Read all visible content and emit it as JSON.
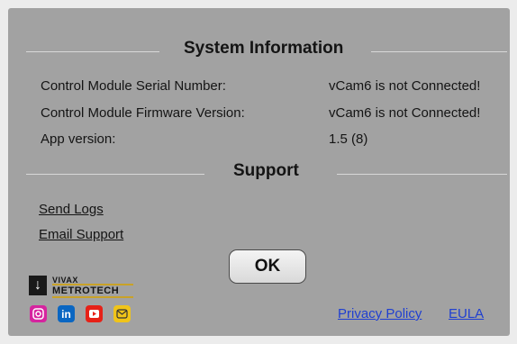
{
  "system_info": {
    "title": "System Information",
    "rows": [
      {
        "label": "Control Module Serial Number:",
        "value": "vCam6 is not Connected!"
      },
      {
        "label": "Control Module Firmware Version:",
        "value": "vCam6 is not Connected!"
      },
      {
        "label": "App version:",
        "value": "1.5 (8)"
      }
    ]
  },
  "support": {
    "title": "Support",
    "send_logs": "Send Logs",
    "email_support": "Email Support"
  },
  "ok_label": "OK",
  "logo": {
    "line1": "VIVAX",
    "line2": "METROTECH"
  },
  "social": [
    {
      "icon": "instagram-icon",
      "color": "#d6249f"
    },
    {
      "icon": "linkedin-icon",
      "color": "#0a66c2"
    },
    {
      "icon": "youtube-icon",
      "color": "#e62117"
    },
    {
      "icon": "email-icon",
      "color": "#f0c419"
    }
  ],
  "footer": {
    "privacy_policy": "Privacy Policy",
    "eula": "EULA"
  }
}
